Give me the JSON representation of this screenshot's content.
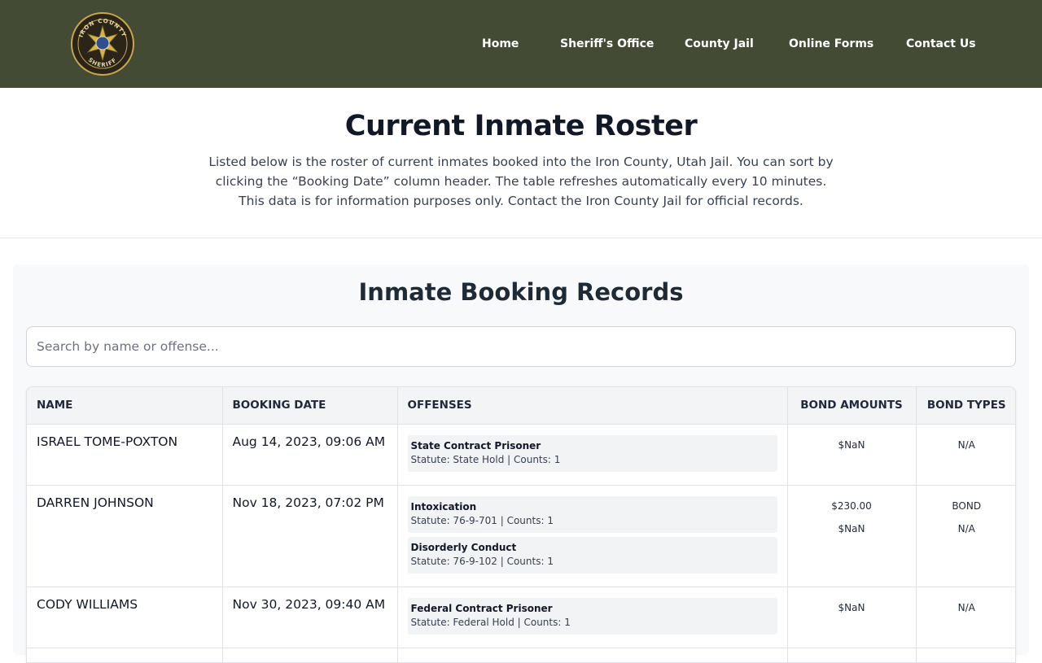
{
  "header": {
    "logo_text_top": "IRON COUNTY",
    "logo_text_bottom": "SHERIFF",
    "nav": [
      {
        "label": "Home"
      },
      {
        "label": "Sheriff's Office"
      },
      {
        "label": "County Jail"
      },
      {
        "label": "Online Forms"
      },
      {
        "label": "Contact Us"
      }
    ],
    "bg_color": "#434b34"
  },
  "intro": {
    "title": "Current Inmate Roster",
    "description": "Listed below is the roster of current inmates booked into the Iron County, Utah Jail. You can sort by clicking the “Booking Date” column header. The table refreshes automatically every 10 minutes. This data is for information purposes only. Contact the Iron County Jail for official records."
  },
  "records": {
    "title": "Inmate Booking Records",
    "search_placeholder": "Search by name or offense...",
    "columns": [
      "NAME",
      "BOOKING DATE",
      "OFFENSES",
      "BOND AMOUNTS",
      "BOND TYPES"
    ],
    "rows": [
      {
        "name": "ISRAEL TOME-POXTON",
        "booking_date": "Aug 14, 2023, 09:06 AM",
        "offenses": [
          {
            "title": "State Contract Prisoner",
            "statute": "Statute: State Hold | Counts: 1"
          }
        ],
        "bond_amounts": [
          "$NaN"
        ],
        "bond_types": [
          "N/A"
        ]
      },
      {
        "name": "DARREN JOHNSON",
        "booking_date": "Nov 18, 2023, 07:02 PM",
        "offenses": [
          {
            "title": "Intoxication",
            "statute": "Statute: 76-9-701 | Counts: 1"
          },
          {
            "title": "Disorderly Conduct",
            "statute": "Statute: 76-9-102 | Counts: 1"
          }
        ],
        "bond_amounts": [
          "$230.00",
          "$NaN"
        ],
        "bond_types": [
          "BOND",
          "N/A"
        ]
      },
      {
        "name": "CODY WILLIAMS",
        "booking_date": "Nov 30, 2023, 09:40 AM",
        "offenses": [
          {
            "title": "Federal Contract Prisoner",
            "statute": "Statute: Federal Hold | Counts: 1"
          }
        ],
        "bond_amounts": [
          "$NaN"
        ],
        "bond_types": [
          "N/A"
        ]
      }
    ]
  }
}
